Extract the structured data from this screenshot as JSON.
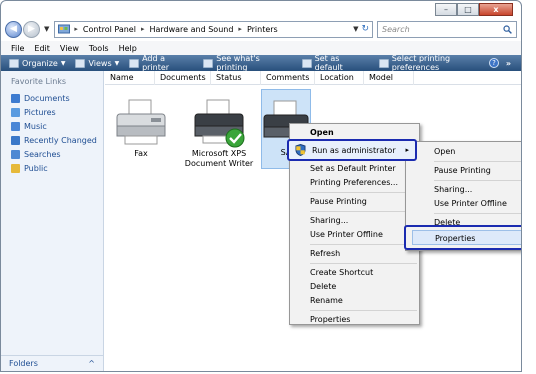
{
  "window": {
    "controls": {
      "min": "–",
      "max": "□",
      "close": "x"
    }
  },
  "address": {
    "segments": [
      "Control Panel",
      "Hardware and Sound",
      "Printers"
    ],
    "separator": "▸",
    "refresh_glyph": "↻",
    "search_placeholder": "Search"
  },
  "menubar": [
    "File",
    "Edit",
    "View",
    "Tools",
    "Help"
  ],
  "toolbar": {
    "organize": "Organize",
    "views": "Views",
    "add_printer": "Add a printer",
    "see_printing": "See what's printing",
    "set_default": "Set as default",
    "select_prefs": "Select printing preferences",
    "more": "»",
    "help": "?"
  },
  "sidebar": {
    "title": "Favorite Links",
    "items": [
      {
        "label": "Documents",
        "icon": "documents-icon",
        "color": "#3d7bd0"
      },
      {
        "label": "Pictures",
        "icon": "pictures-icon",
        "color": "#5a9be0"
      },
      {
        "label": "Music",
        "icon": "music-icon",
        "color": "#4a86d6"
      },
      {
        "label": "Recently Changed",
        "icon": "recent-icon",
        "color": "#3a78c9"
      },
      {
        "label": "Searches",
        "icon": "searches-icon",
        "color": "#4d88d3"
      },
      {
        "label": "Public",
        "icon": "public-icon",
        "color": "#e6b93a"
      }
    ],
    "folders": "Folders",
    "folders_chevron": "^"
  },
  "columns": [
    "Name",
    "Documents",
    "Status",
    "Comments",
    "Location",
    "Model"
  ],
  "printers": [
    {
      "label": "Fax"
    },
    {
      "label": "Microsoft XPS Document Writer"
    },
    {
      "label": "SA"
    }
  ],
  "context_menu": {
    "open": "Open",
    "run_as_admin": "Run as administrator",
    "submenu_arrow": "▸",
    "items_a": [
      "Set as Default Printer",
      "Printing Preferences..."
    ],
    "items_b": [
      "Pause Printing"
    ],
    "items_c": [
      "Sharing...",
      "Use Printer Offline"
    ],
    "items_d": [
      "Refresh"
    ],
    "items_e": [
      "Create Shortcut",
      "Delete",
      "Rename"
    ],
    "items_f": [
      "Properties"
    ]
  },
  "submenu": {
    "items_a": [
      "Open"
    ],
    "items_b": [
      "Pause Printing"
    ],
    "items_c": [
      "Sharing...",
      "Use Printer Offline"
    ],
    "items_d": [
      "Delete"
    ],
    "properties": "Properties"
  },
  "colors": {
    "toolbar": "#284f7c",
    "highlight_border": "#1b2bb0",
    "sidebar_bg": "#eef3fa",
    "link": "#1f4e93"
  }
}
